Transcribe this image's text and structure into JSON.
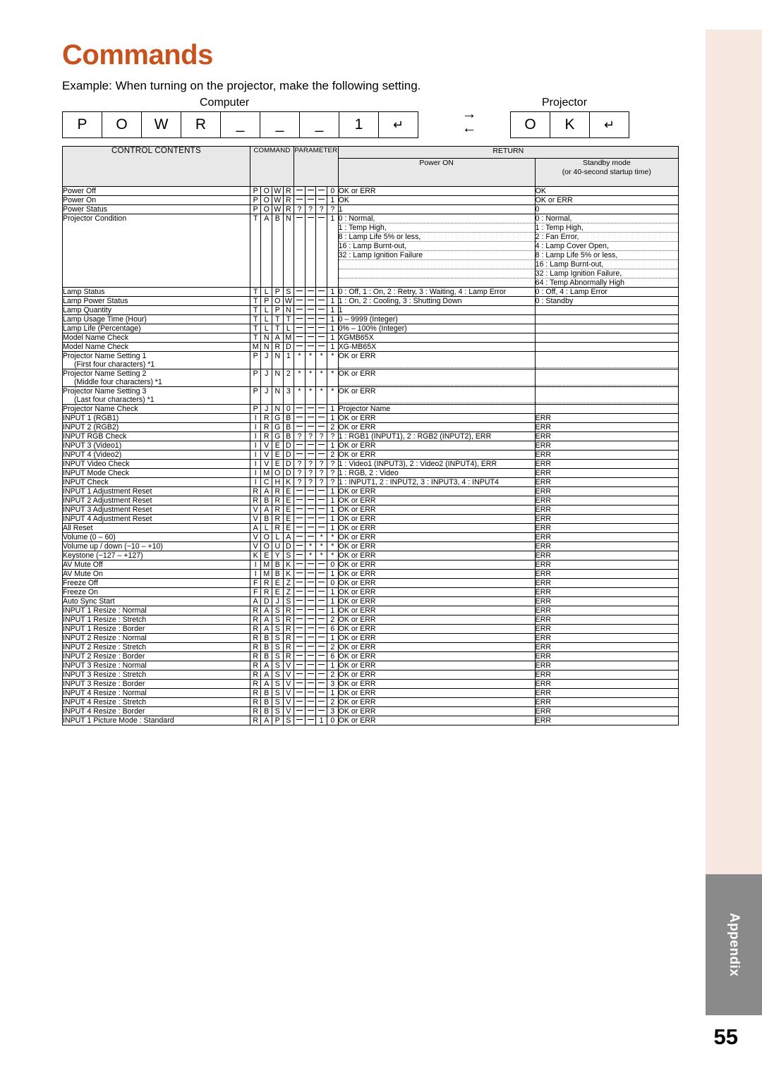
{
  "page": {
    "title": "Commands",
    "example_line": "Example: When turning on the projector, make the following setting.",
    "computer_label": "Computer",
    "projector_label": "Projector",
    "page_number": "55",
    "tab_label": "Appendix",
    "accent_color": "#c8521e",
    "arrow_right": "→",
    "arrow_left": "←"
  },
  "keys": {
    "computer": [
      "P",
      "O",
      "W",
      "R",
      "_",
      "_",
      "_",
      "1",
      "↵"
    ],
    "projector": [
      "O",
      "K",
      "↵"
    ]
  },
  "table": {
    "headers": {
      "control_contents": "CONTROL CONTENTS",
      "command": "COMMAND",
      "parameter": "PARAMETER",
      "return": "RETURN",
      "power_on": "Power ON",
      "standby": "Standby mode",
      "standby_sub": "(or 40-second startup time)"
    },
    "rows": [
      {
        "name": "Power Off",
        "cmd": [
          "P",
          "O",
          "W",
          "R"
        ],
        "par": [
          "_",
          "_",
          "_",
          "0"
        ],
        "ret": [
          "OK or ERR"
        ],
        "stb": [
          "OK"
        ]
      },
      {
        "name": "Power On",
        "cmd": [
          "P",
          "O",
          "W",
          "R"
        ],
        "par": [
          "_",
          "_",
          "_",
          "1"
        ],
        "ret": [
          "OK"
        ],
        "stb": [
          "OK or ERR"
        ]
      },
      {
        "name": "Power Status",
        "cmd": [
          "P",
          "O",
          "W",
          "R"
        ],
        "par": [
          "?",
          "?",
          "?",
          "?"
        ],
        "ret": [
          "1"
        ],
        "stb": [
          "0"
        ]
      },
      {
        "name": "Projector Condition",
        "cmd": [
          "T",
          "A",
          "B",
          "N"
        ],
        "par": [
          "_",
          "_",
          "_",
          "1"
        ],
        "ret": [
          "0 : Normal,",
          "1 : Temp High,",
          "8 : Lamp Life 5% or less,",
          "16 : Lamp Burnt-out,",
          "32 : Lamp Ignition Failure"
        ],
        "stb": [
          "0 : Normal,",
          "1 : Temp High,",
          "2 : Fan Error,",
          "4 : Lamp Cover Open,",
          "8 : Lamp Life 5% or less,",
          "16 : Lamp Burnt-out,",
          "32 : Lamp Ignition Failure,",
          "64 : Temp Abnormally High"
        ]
      },
      {
        "name": "Lamp Status",
        "cmd": [
          "T",
          "L",
          "P",
          "S"
        ],
        "par": [
          "_",
          "_",
          "_",
          "1"
        ],
        "ret": [
          "0 : Off, 1 : On, 2 : Retry, 3 : Waiting, 4 : Lamp Error"
        ],
        "stb": [
          "0 : Off, 4 : Lamp Error"
        ]
      },
      {
        "name": "Lamp Power Status",
        "cmd": [
          "T",
          "P",
          "O",
          "W"
        ],
        "par": [
          "_",
          "_",
          "_",
          "1"
        ],
        "ret": [
          "1 : On, 2 : Cooling, 3 : Shutting Down"
        ],
        "stb": [
          "0 : Standby"
        ]
      },
      {
        "name": "Lamp Quantity",
        "cmd": [
          "T",
          "L",
          "P",
          "N"
        ],
        "par": [
          "_",
          "_",
          "_",
          "1"
        ],
        "ret": [
          "1"
        ],
        "stb": [
          ""
        ]
      },
      {
        "name": "Lamp Usage Time (Hour)",
        "cmd": [
          "T",
          "L",
          "T",
          "T"
        ],
        "par": [
          "_",
          "_",
          "_",
          "1"
        ],
        "ret": [
          "0 – 9999 (Integer)"
        ],
        "stb": [
          ""
        ]
      },
      {
        "name": "Lamp Life (Percentage)",
        "cmd": [
          "T",
          "L",
          "T",
          "L"
        ],
        "par": [
          "_",
          "_",
          "_",
          "1"
        ],
        "ret": [
          "0% – 100% (Integer)"
        ],
        "stb": [
          ""
        ]
      },
      {
        "name": "Model Name Check",
        "cmd": [
          "T",
          "N",
          "A",
          "M"
        ],
        "par": [
          "_",
          "_",
          "_",
          "1"
        ],
        "ret": [
          "XGMB65X"
        ],
        "stb": [
          ""
        ]
      },
      {
        "name": "Model Name Check",
        "cmd": [
          "M",
          "N",
          "R",
          "D"
        ],
        "par": [
          "_",
          "_",
          "_",
          "1"
        ],
        "ret": [
          "XG-MB65X"
        ],
        "stb": [
          ""
        ]
      },
      {
        "name": "Projector Name Setting 1",
        "name2": "(First four characters) *1",
        "cmd": [
          "P",
          "J",
          "N",
          "1"
        ],
        "par": [
          "*",
          "*",
          "*",
          "*"
        ],
        "ret": [
          "OK or ERR"
        ],
        "stb": [
          ""
        ]
      },
      {
        "name": "Projector Name Setting 2",
        "name2": "(Middle four characters) *1",
        "cmd": [
          "P",
          "J",
          "N",
          "2"
        ],
        "par": [
          "*",
          "*",
          "*",
          "*"
        ],
        "ret": [
          "OK or ERR"
        ],
        "stb": [
          ""
        ]
      },
      {
        "name": "Projector Name Setting 3",
        "name2": "(Last four characters) *1",
        "cmd": [
          "P",
          "J",
          "N",
          "3"
        ],
        "par": [
          "*",
          "*",
          "*",
          "*"
        ],
        "ret": [
          "OK or ERR"
        ],
        "stb": [
          ""
        ]
      },
      {
        "name": "Projector Name Check",
        "cmd": [
          "P",
          "J",
          "N",
          "0"
        ],
        "par": [
          "_",
          "_",
          "_",
          "1"
        ],
        "ret": [
          "Projector Name"
        ],
        "stb": [
          ""
        ]
      },
      {
        "name": "INPUT 1 (RGB1)",
        "cmd": [
          "I",
          "R",
          "G",
          "B"
        ],
        "par": [
          "_",
          "_",
          "_",
          "1"
        ],
        "ret": [
          "OK or ERR"
        ],
        "stb": [
          "ERR"
        ]
      },
      {
        "name": "INPUT 2 (RGB2)",
        "cmd": [
          "I",
          "R",
          "G",
          "B"
        ],
        "par": [
          "_",
          "_",
          "_",
          "2"
        ],
        "ret": [
          "OK or ERR"
        ],
        "stb": [
          "ERR"
        ]
      },
      {
        "name": "INPUT RGB Check",
        "cmd": [
          "I",
          "R",
          "G",
          "B"
        ],
        "par": [
          "?",
          "?",
          "?",
          "?"
        ],
        "ret": [
          "1 : RGB1 (INPUT1), 2 : RGB2 (INPUT2), ERR"
        ],
        "stb": [
          "ERR"
        ]
      },
      {
        "name": "INPUT 3 (Video1)",
        "cmd": [
          "I",
          "V",
          "E",
          "D"
        ],
        "par": [
          "_",
          "_",
          "_",
          "1"
        ],
        "ret": [
          "OK or ERR"
        ],
        "stb": [
          "ERR"
        ]
      },
      {
        "name": "INPUT 4 (Video2)",
        "cmd": [
          "I",
          "V",
          "E",
          "D"
        ],
        "par": [
          "_",
          "_",
          "_",
          "2"
        ],
        "ret": [
          "OK or ERR"
        ],
        "stb": [
          "ERR"
        ]
      },
      {
        "name": "INPUT Video Check",
        "cmd": [
          "I",
          "V",
          "E",
          "D"
        ],
        "par": [
          "?",
          "?",
          "?",
          "?"
        ],
        "ret": [
          "1 : Video1 (INPUT3), 2 : Video2 (INPUT4), ERR"
        ],
        "stb": [
          "ERR"
        ]
      },
      {
        "name": "INPUT Mode Check",
        "cmd": [
          "I",
          "M",
          "O",
          "D"
        ],
        "par": [
          "?",
          "?",
          "?",
          "?"
        ],
        "ret": [
          "1 : RGB, 2 : Video"
        ],
        "stb": [
          "ERR"
        ]
      },
      {
        "name": "INPUT Check",
        "cmd": [
          "I",
          "C",
          "H",
          "K"
        ],
        "par": [
          "?",
          "?",
          "?",
          "?"
        ],
        "ret": [
          "1 : INPUT1, 2 : INPUT2, 3 : INPUT3, 4 : INPUT4"
        ],
        "stb": [
          "ERR"
        ]
      },
      {
        "name": "INPUT 1 Adjustment Reset",
        "cmd": [
          "R",
          "A",
          "R",
          "E"
        ],
        "par": [
          "_",
          "_",
          "_",
          "1"
        ],
        "ret": [
          "OK or ERR"
        ],
        "stb": [
          "ERR"
        ]
      },
      {
        "name": "INPUT 2 Adjustment Reset",
        "cmd": [
          "R",
          "B",
          "R",
          "E"
        ],
        "par": [
          "_",
          "_",
          "_",
          "1"
        ],
        "ret": [
          "OK or ERR"
        ],
        "stb": [
          "ERR"
        ]
      },
      {
        "name": "INPUT 3 Adjustment Reset",
        "cmd": [
          "V",
          "A",
          "R",
          "E"
        ],
        "par": [
          "_",
          "_",
          "_",
          "1"
        ],
        "ret": [
          "OK or ERR"
        ],
        "stb": [
          "ERR"
        ]
      },
      {
        "name": "INPUT 4 Adjustment Reset",
        "cmd": [
          "V",
          "B",
          "R",
          "E"
        ],
        "par": [
          "_",
          "_",
          "_",
          "1"
        ],
        "ret": [
          "OK or ERR"
        ],
        "stb": [
          "ERR"
        ]
      },
      {
        "name": "All Reset",
        "cmd": [
          "A",
          "L",
          "R",
          "E"
        ],
        "par": [
          "_",
          "_",
          "_",
          "1"
        ],
        "ret": [
          "OK or ERR"
        ],
        "stb": [
          "ERR"
        ]
      },
      {
        "name": "Volume (0 – 60)",
        "cmd": [
          "V",
          "O",
          "L",
          "A"
        ],
        "par": [
          "_",
          "_",
          "*",
          "*"
        ],
        "ret": [
          "OK or ERR"
        ],
        "stb": [
          "ERR"
        ]
      },
      {
        "name": "Volume up / down (−10 – +10)",
        "cmd": [
          "V",
          "O",
          "U",
          "D"
        ],
        "par": [
          "_",
          "*",
          "*",
          "*"
        ],
        "ret": [
          "OK or ERR"
        ],
        "stb": [
          "ERR"
        ]
      },
      {
        "name": "Keystone (−127 – +127)",
        "cmd": [
          "K",
          "E",
          "Y",
          "S"
        ],
        "par": [
          "_",
          "*",
          "*",
          "*"
        ],
        "ret": [
          "OK or ERR"
        ],
        "stb": [
          "ERR"
        ]
      },
      {
        "name": "AV Mute Off",
        "cmd": [
          "I",
          "M",
          "B",
          "K"
        ],
        "par": [
          "_",
          "_",
          "_",
          "0"
        ],
        "ret": [
          "OK or ERR"
        ],
        "stb": [
          "ERR"
        ]
      },
      {
        "name": "AV Mute On",
        "cmd": [
          "I",
          "M",
          "B",
          "K"
        ],
        "par": [
          "_",
          "_",
          "_",
          "1"
        ],
        "ret": [
          "OK or ERR"
        ],
        "stb": [
          "ERR"
        ]
      },
      {
        "name": "Freeze Off",
        "cmd": [
          "F",
          "R",
          "E",
          "Z"
        ],
        "par": [
          "_",
          "_",
          "_",
          "0"
        ],
        "ret": [
          "OK or ERR"
        ],
        "stb": [
          "ERR"
        ]
      },
      {
        "name": "Freeze On",
        "cmd": [
          "F",
          "R",
          "E",
          "Z"
        ],
        "par": [
          "_",
          "_",
          "_",
          "1"
        ],
        "ret": [
          "OK or ERR"
        ],
        "stb": [
          "ERR"
        ]
      },
      {
        "name": "Auto Sync Start",
        "cmd": [
          "A",
          "D",
          "J",
          "S"
        ],
        "par": [
          "_",
          "_",
          "_",
          "1"
        ],
        "ret": [
          "OK or ERR"
        ],
        "stb": [
          "ERR"
        ]
      },
      {
        "name": "INPUT 1 Resize : Normal",
        "cmd": [
          "R",
          "A",
          "S",
          "R"
        ],
        "par": [
          "_",
          "_",
          "_",
          "1"
        ],
        "ret": [
          "OK or ERR"
        ],
        "stb": [
          "ERR"
        ]
      },
      {
        "name": "INPUT 1 Resize : Stretch",
        "cmd": [
          "R",
          "A",
          "S",
          "R"
        ],
        "par": [
          "_",
          "_",
          "_",
          "2"
        ],
        "ret": [
          "OK or ERR"
        ],
        "stb": [
          "ERR"
        ]
      },
      {
        "name": "INPUT 1 Resize : Border",
        "cmd": [
          "R",
          "A",
          "S",
          "R"
        ],
        "par": [
          "_",
          "_",
          "_",
          "6"
        ],
        "ret": [
          "OK or ERR"
        ],
        "stb": [
          "ERR"
        ]
      },
      {
        "name": "INPUT 2 Resize : Normal",
        "cmd": [
          "R",
          "B",
          "S",
          "R"
        ],
        "par": [
          "_",
          "_",
          "_",
          "1"
        ],
        "ret": [
          "OK or ERR"
        ],
        "stb": [
          "ERR"
        ]
      },
      {
        "name": "INPUT 2 Resize : Stretch",
        "cmd": [
          "R",
          "B",
          "S",
          "R"
        ],
        "par": [
          "_",
          "_",
          "_",
          "2"
        ],
        "ret": [
          "OK or ERR"
        ],
        "stb": [
          "ERR"
        ]
      },
      {
        "name": "INPUT 2 Resize : Border",
        "cmd": [
          "R",
          "B",
          "S",
          "R"
        ],
        "par": [
          "_",
          "_",
          "_",
          "6"
        ],
        "ret": [
          "OK or ERR"
        ],
        "stb": [
          "ERR"
        ]
      },
      {
        "name": "INPUT 3 Resize : Normal",
        "cmd": [
          "R",
          "A",
          "S",
          "V"
        ],
        "par": [
          "_",
          "_",
          "_",
          "1"
        ],
        "ret": [
          "OK or ERR"
        ],
        "stb": [
          "ERR"
        ]
      },
      {
        "name": "INPUT 3 Resize : Stretch",
        "cmd": [
          "R",
          "A",
          "S",
          "V"
        ],
        "par": [
          "_",
          "_",
          "_",
          "2"
        ],
        "ret": [
          "OK or ERR"
        ],
        "stb": [
          "ERR"
        ]
      },
      {
        "name": "INPUT 3 Resize : Border",
        "cmd": [
          "R",
          "A",
          "S",
          "V"
        ],
        "par": [
          "_",
          "_",
          "_",
          "3"
        ],
        "ret": [
          "OK or ERR"
        ],
        "stb": [
          "ERR"
        ]
      },
      {
        "name": "INPUT 4 Resize : Normal",
        "cmd": [
          "R",
          "B",
          "S",
          "V"
        ],
        "par": [
          "_",
          "_",
          "_",
          "1"
        ],
        "ret": [
          "OK or ERR"
        ],
        "stb": [
          "ERR"
        ]
      },
      {
        "name": "INPUT 4 Resize : Stretch",
        "cmd": [
          "R",
          "B",
          "S",
          "V"
        ],
        "par": [
          "_",
          "_",
          "_",
          "2"
        ],
        "ret": [
          "OK or ERR"
        ],
        "stb": [
          "ERR"
        ]
      },
      {
        "name": "INPUT 4 Resize : Border",
        "cmd": [
          "R",
          "B",
          "S",
          "V"
        ],
        "par": [
          "_",
          "_",
          "_",
          "3"
        ],
        "ret": [
          "OK or ERR"
        ],
        "stb": [
          "ERR"
        ]
      },
      {
        "name": "INPUT 1 Picture Mode : Standard",
        "cmd": [
          "R",
          "A",
          "P",
          "S"
        ],
        "par": [
          "_",
          "_",
          "1",
          "0"
        ],
        "ret": [
          "OK or ERR"
        ],
        "stb": [
          "ERR"
        ]
      }
    ]
  }
}
